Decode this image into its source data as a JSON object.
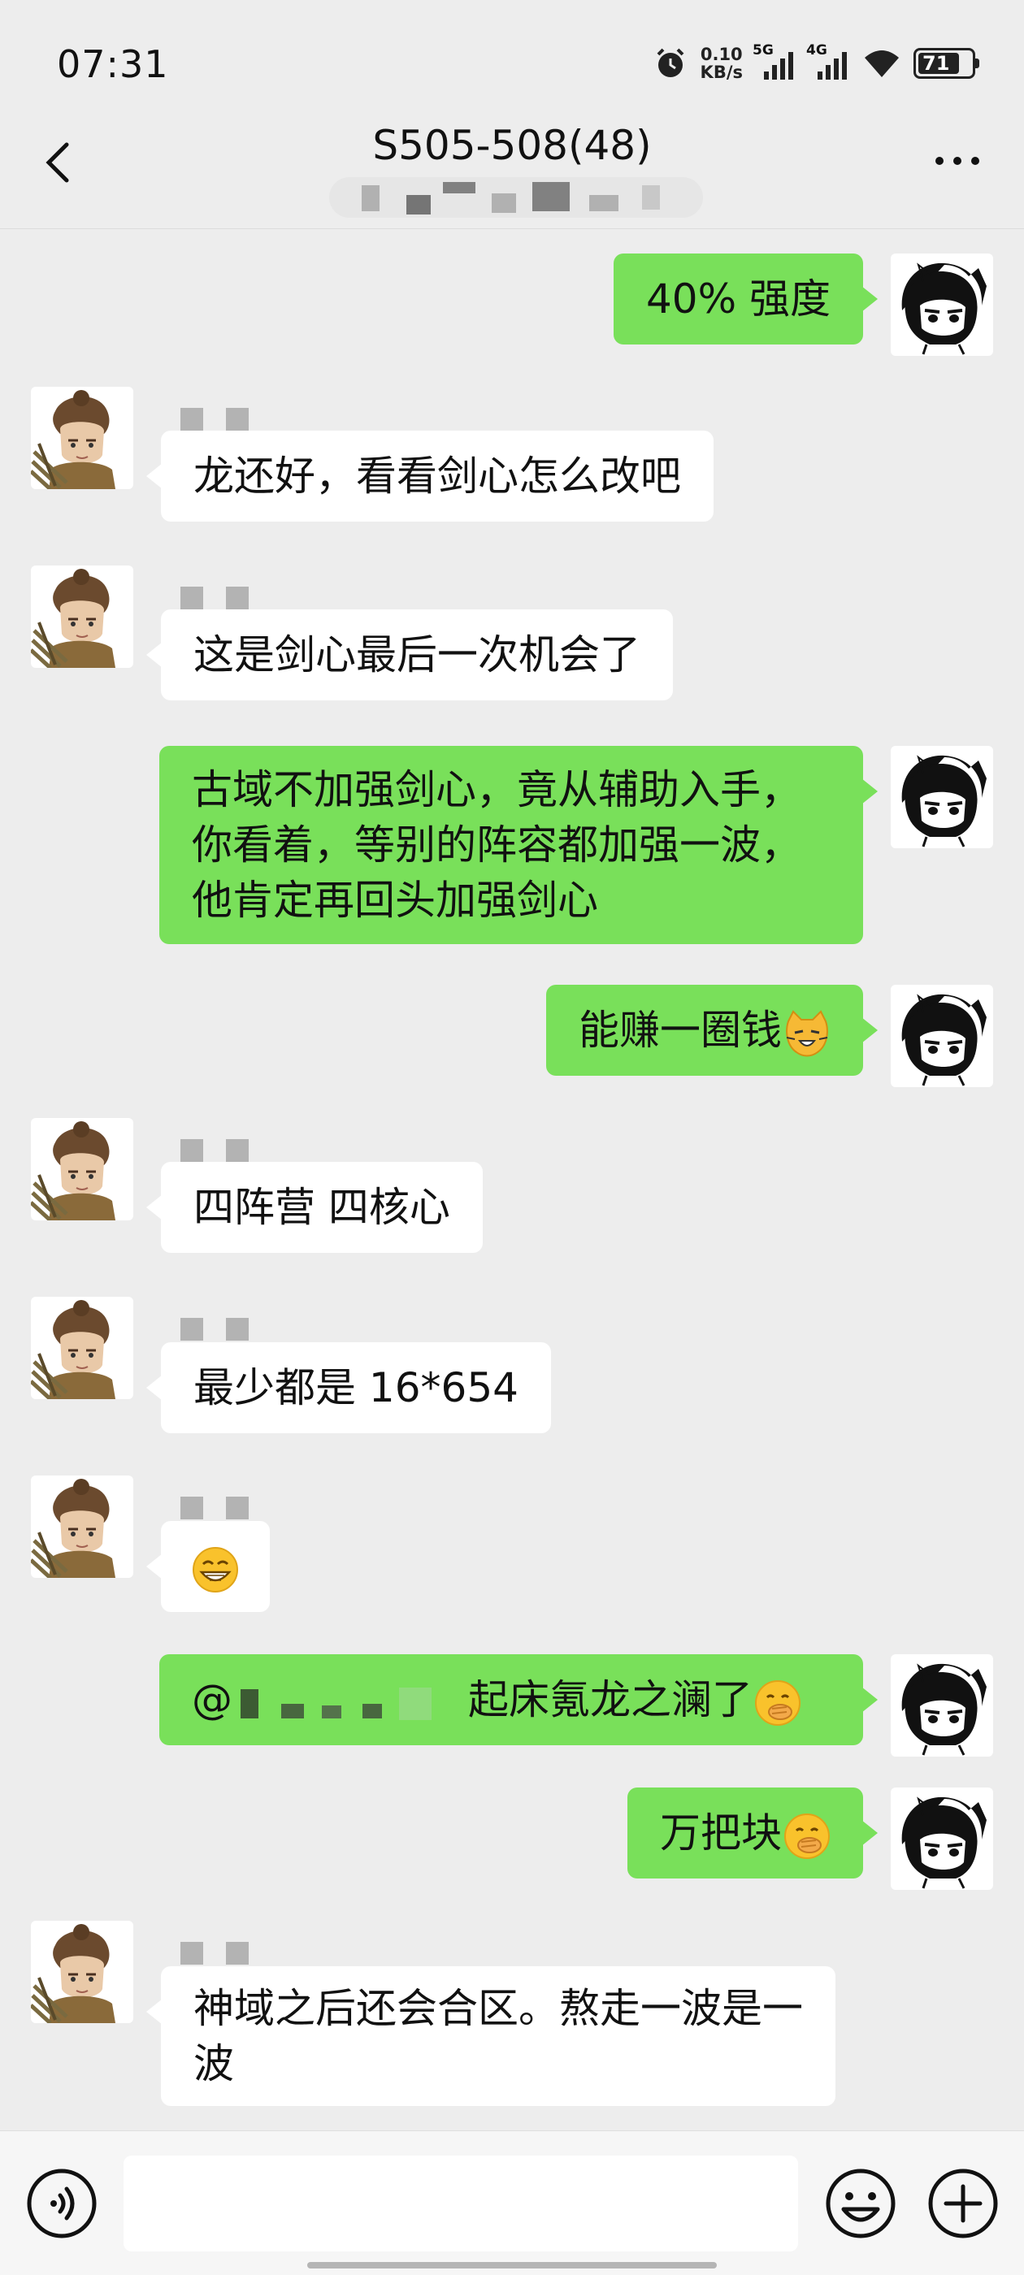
{
  "status_bar": {
    "time": "07:31",
    "net_speed_value": "0.10",
    "net_speed_unit": "KB/s",
    "network_1": "5G",
    "network_2": "4G",
    "battery": "71"
  },
  "header": {
    "title": "S505-508(48)",
    "back_icon": "chevron-left-icon",
    "more_icon": "ellipsis-icon"
  },
  "messages": [
    {
      "sender": "me",
      "text": "40% 强度"
    },
    {
      "sender": "other",
      "text": "龙还好，看看剑心怎么改吧"
    },
    {
      "sender": "other",
      "text": "这是剑心最后一次机会了"
    },
    {
      "sender": "me",
      "lines": [
        "古域不加强剑心，竟从辅助入手，",
        "你看着，等别的阵容都加强一波，",
        "他肯定再回头加强剑心"
      ]
    },
    {
      "sender": "me",
      "text": "能赚一圈钱",
      "emoji": "cat-face-emoji"
    },
    {
      "sender": "other",
      "text": "四阵营 四核心"
    },
    {
      "sender": "other",
      "text": "最少都是 16*654"
    },
    {
      "sender": "other",
      "emoji": "grinning-emoji"
    },
    {
      "sender": "me",
      "prefix": "@",
      "text": "起床氪龙之澜了",
      "emoji": "hand-over-mouth-emoji"
    },
    {
      "sender": "me",
      "text": "万把块",
      "emoji": "hand-over-mouth-emoji"
    },
    {
      "sender": "other",
      "lines": [
        "神域之后还会合区。熬走一波是一",
        "波"
      ]
    }
  ],
  "input_bar": {
    "voice_icon": "voice-icon",
    "emoji_icon": "emoji-icon",
    "plus_icon": "plus-icon"
  },
  "colors": {
    "background": "#ededed",
    "my_bubble": "#79e05a",
    "their_bubble": "#ffffff"
  }
}
